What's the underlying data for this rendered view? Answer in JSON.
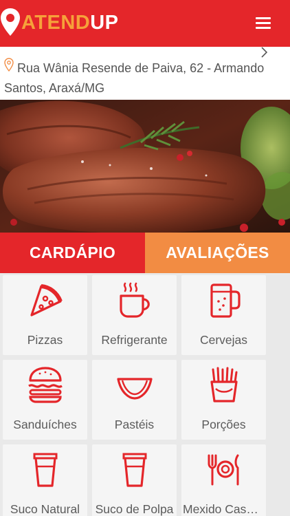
{
  "app": {
    "logo_a": "ATEND",
    "logo_b": "UP",
    "brand_red": "#e4262a",
    "brand_orange": "#f28c43",
    "logo_orange": "#f6a13a"
  },
  "header": {
    "menu_icon": "hamburger-menu-icon"
  },
  "address": {
    "text": "Rua Wânia Resende de Paiva, 62 - Armando Santos, Araxá/MG",
    "pin_icon": "location-pin-icon",
    "chevron_icon": "chevron-right-icon"
  },
  "hero": {
    "alt": "grilled steak photo"
  },
  "tabs": [
    {
      "label": "CARDÁPIO",
      "active": true
    },
    {
      "label": "AVALIAÇÕES",
      "active": false
    }
  ],
  "categories": [
    {
      "label": "Pizzas",
      "icon": "pizza-icon"
    },
    {
      "label": "Refrigerante",
      "icon": "hot-cup-icon"
    },
    {
      "label": "Cervejas",
      "icon": "beer-mug-icon"
    },
    {
      "label": "Sanduíches",
      "icon": "burger-icon"
    },
    {
      "label": "Pastéis",
      "icon": "pastel-icon"
    },
    {
      "label": "Porções",
      "icon": "fries-icon"
    },
    {
      "label": "Suco Natural",
      "icon": "cup-icon"
    },
    {
      "label": "Suco de Polpa",
      "icon": "cup-icon"
    },
    {
      "label": "Mexido Caseiro",
      "icon": "cutlery-plate-icon"
    }
  ]
}
